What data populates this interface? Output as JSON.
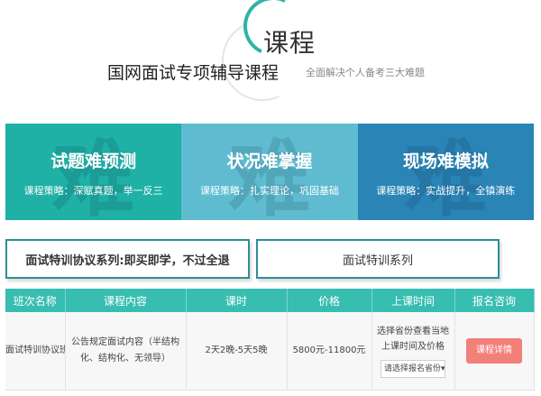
{
  "header": {
    "title": "课程",
    "subtitle": "国网面试专项辅导课程",
    "note": "全面解决个人备考三大难题"
  },
  "cards": [
    {
      "title": "试题难预测",
      "desc": "课程策略：深赋真题，举一反三",
      "bg_char": "难",
      "color": "#1fb0a6"
    },
    {
      "title": "状况难掌握",
      "desc": "课程策略：扎实理论，巩固基础",
      "bg_char": "难",
      "color": "#5fbcd0"
    },
    {
      "title": "现场难模拟",
      "desc": "课程策略：实战提升，全镇演练",
      "bg_char": "难",
      "color": "#2a84b6"
    }
  ],
  "tabs": [
    {
      "label": "面试特训协议系列:即买即学，不过全退"
    },
    {
      "label": "面试特训系列"
    }
  ],
  "table": {
    "headers": [
      "班次名称",
      "课程内容",
      "课时",
      "价格",
      "上课时间",
      "报名咨询"
    ],
    "row": {
      "name": "面试特训协议班",
      "content": "公告规定面试内容（半结构化、结构化、无领导）",
      "hours": "2天2晚-5天5晚",
      "price": "5800元-11800元",
      "schedule_hint": "选择省份查看当地上课时间及价格",
      "select_value": "请选择报名省份",
      "button": "课程详情"
    }
  }
}
